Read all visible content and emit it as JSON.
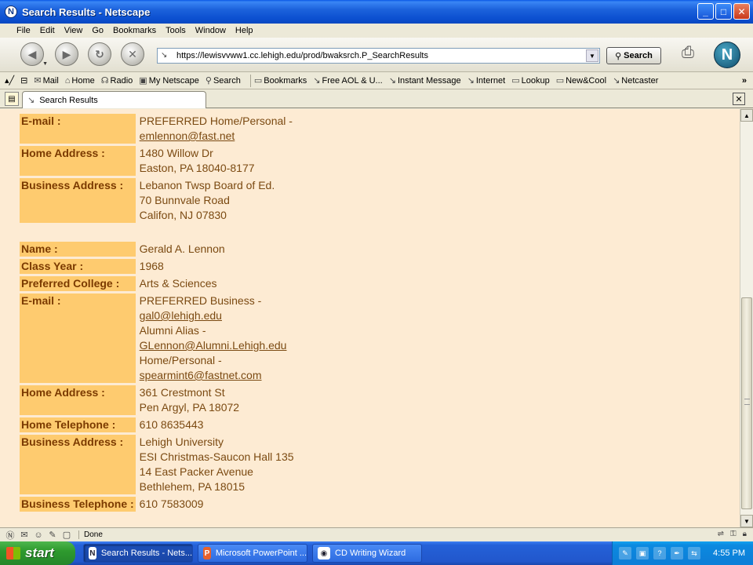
{
  "window": {
    "title": "Search Results - Netscape",
    "app_icon": "N",
    "minimize": "_",
    "maximize": "□",
    "close": "✕"
  },
  "menu": [
    "File",
    "Edit",
    "View",
    "Go",
    "Bookmarks",
    "Tools",
    "Window",
    "Help"
  ],
  "nav": {
    "url": "https://lewisvvww1.cc.lehigh.edu/prod/bwaksrch.P_SearchResults",
    "search_label": "Search",
    "logo": "N"
  },
  "personal_toolbar": [
    {
      "icon": "mail-icon",
      "glyph": "✉",
      "label": "Mail"
    },
    {
      "icon": "home-icon",
      "glyph": "⌂",
      "label": "Home"
    },
    {
      "icon": "radio-icon",
      "glyph": "☊",
      "label": "Radio"
    },
    {
      "icon": "mynetscape-icon",
      "glyph": "▣",
      "label": "My Netscape"
    },
    {
      "icon": "search-icon",
      "glyph": "⚲",
      "label": "Search"
    },
    {
      "icon": "bookmarks-icon",
      "glyph": "▭",
      "label": "Bookmarks"
    },
    {
      "icon": "link-icon",
      "glyph": "↘",
      "label": "Free AOL & U..."
    },
    {
      "icon": "link-icon",
      "glyph": "↘",
      "label": "Instant Message"
    },
    {
      "icon": "link-icon",
      "glyph": "↘",
      "label": "Internet"
    },
    {
      "icon": "folder-icon",
      "glyph": "▭",
      "label": "Lookup"
    },
    {
      "icon": "folder-icon",
      "glyph": "▭",
      "label": "New&Cool"
    },
    {
      "icon": "link-icon",
      "glyph": "↘",
      "label": "Netcaster"
    }
  ],
  "tab": {
    "label": "Search Results"
  },
  "records": [
    {
      "label": "E-mail :",
      "lines": [
        {
          "text": "PREFERRED Home/Personal -"
        },
        {
          "text": "emlennon@fast.net",
          "link": true
        }
      ]
    },
    {
      "label": "Home Address :",
      "lines": [
        {
          "text": "1480 Willow Dr"
        },
        {
          "text": "Easton, PA 18040-8177"
        }
      ]
    },
    {
      "label": "Business Address :",
      "lines": [
        {
          "text": "Lebanon Twsp Board of Ed."
        },
        {
          "text": "70 Bunnvale Road"
        },
        {
          "text": "Califon, NJ 07830"
        }
      ]
    },
    {
      "spacer": true
    },
    {
      "label": "Name :",
      "lines": [
        {
          "text": "Gerald A. Lennon"
        }
      ]
    },
    {
      "label": "Class Year :",
      "lines": [
        {
          "text": "1968"
        }
      ]
    },
    {
      "label": "Preferred College :",
      "lines": [
        {
          "text": "Arts & Sciences"
        }
      ]
    },
    {
      "label": "E-mail :",
      "lines": [
        {
          "text": "PREFERRED Business -"
        },
        {
          "text": "gal0@lehigh.edu",
          "link": true
        },
        {
          "text": "Alumni Alias -"
        },
        {
          "text": "GLennon@Alumni.Lehigh.edu",
          "link": true
        },
        {
          "text": "Home/Personal -"
        },
        {
          "text": "spearmint6@fastnet.com",
          "link": true
        }
      ]
    },
    {
      "label": "Home Address :",
      "lines": [
        {
          "text": "361 Crestmont St"
        },
        {
          "text": "Pen Argyl, PA 18072"
        }
      ]
    },
    {
      "label": "Home Telephone :",
      "lines": [
        {
          "text": "610 8635443"
        }
      ]
    },
    {
      "label": "Business Address :",
      "lines": [
        {
          "text": "Lehigh University"
        },
        {
          "text": "ESI Christmas-Saucon Hall 135"
        },
        {
          "text": "14 East Packer Avenue"
        },
        {
          "text": "Bethlehem, PA 18015"
        }
      ]
    },
    {
      "label": "Business Telephone :",
      "lines": [
        {
          "text": "610 7583009"
        }
      ]
    }
  ],
  "status": {
    "text": "Done"
  },
  "taskbar": {
    "start": "start",
    "tasks": [
      {
        "label": "Search Results - Nets...",
        "active": true,
        "icon": "netscape-icon",
        "glyph": "N"
      },
      {
        "label": "Microsoft PowerPoint ...",
        "active": false,
        "icon": "powerpoint-icon",
        "glyph": "P"
      },
      {
        "label": "CD Writing Wizard",
        "active": false,
        "icon": "cd-icon",
        "glyph": "◉"
      }
    ],
    "clock": "4:55 PM"
  }
}
